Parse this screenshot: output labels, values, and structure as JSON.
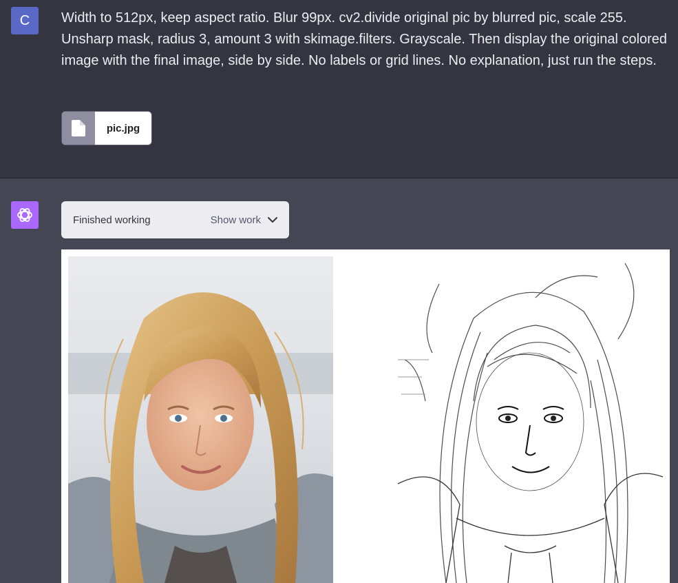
{
  "user": {
    "avatar_initial": "C",
    "message": "Width to 512px, keep aspect ratio. Blur 99px. cv2.divide original pic by blurred pic, scale 255. Unsharp mask, radius 3, amount 3 with skimage.filters. Grayscale. Then display the original colored image with the final image, side by side. No labels or grid lines. No explanation, just run the steps.",
    "attachment": {
      "icon": "file-icon",
      "name": "pic.jpg"
    }
  },
  "assistant": {
    "avatar_icon": "openai-logo-icon",
    "status": "Finished working",
    "show_work_label": "Show work",
    "show_work_icon": "chevron-down-icon"
  },
  "colors": {
    "user_bg": "#343541",
    "assistant_bg": "#444654",
    "user_avatar": "#5a69c6",
    "assistant_avatar": "#ab68ff"
  }
}
